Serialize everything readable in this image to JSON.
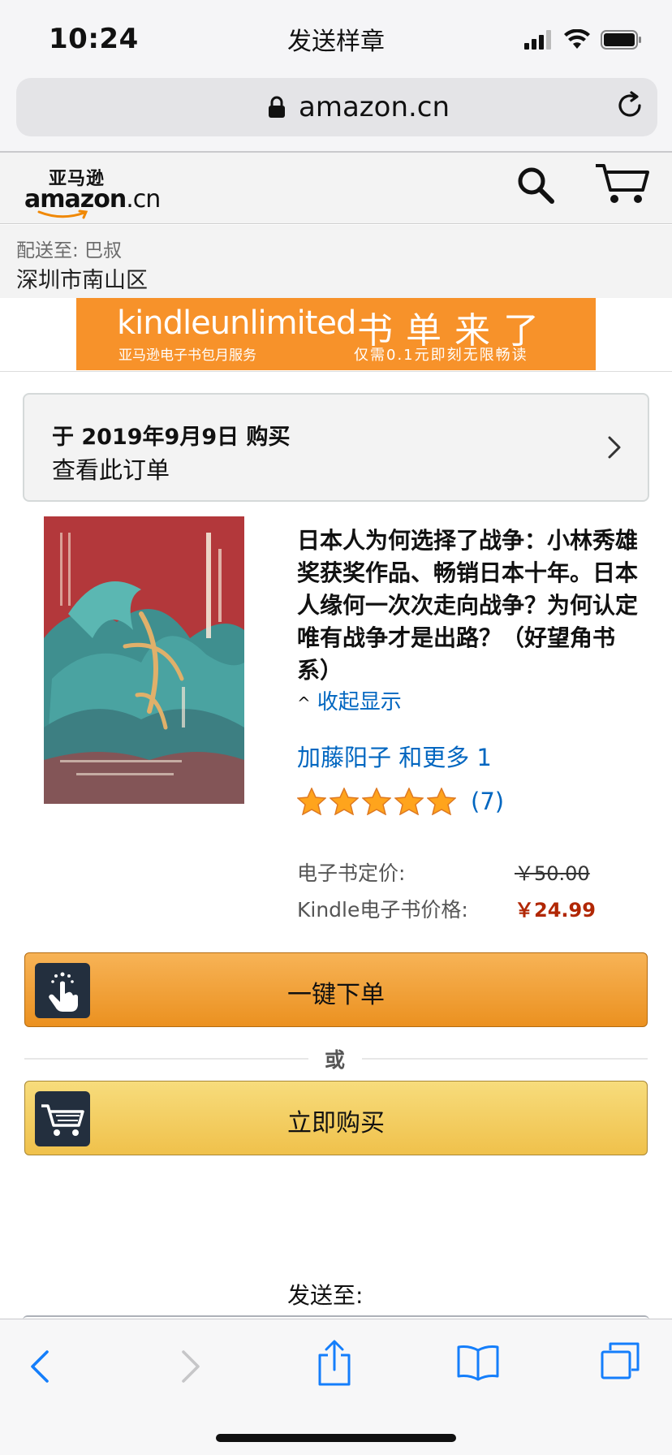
{
  "status_bar": {
    "time": "10:24"
  },
  "browser": {
    "url": "amazon.cn"
  },
  "header": {
    "logo_cn": "亚马逊",
    "logo_en": "amazon",
    "logo_suffix": ".cn"
  },
  "delivery": {
    "label": "配送至: 巴叔",
    "area": "深圳市南山区"
  },
  "banner": {
    "brand": "kindleunlimited",
    "brand_sub": "亚马逊电子书包月服务",
    "headline": "书单来了",
    "subline": "仅需0.1元即刻无限畅读",
    "bg_color": "#f7922a"
  },
  "order": {
    "date_text": "于 2019年9月9日 购买",
    "link_text": "查看此订单"
  },
  "book": {
    "title": "日本人为何选择了战争：小林秀雄奖获奖作品、畅销日本十年。日本人缘何一次次走向战争？为何认定唯有战争才是出路？（好望角书系）",
    "collapse_label": "收起显示",
    "author": "加藤阳子 和更多 1",
    "rating": 5,
    "rating_count": "(7)"
  },
  "prices": {
    "list_label": "电子书定价:",
    "list_value": "￥50.00",
    "kindle_label": "Kindle电子书价格:",
    "kindle_value": "￥24.99"
  },
  "buttons": {
    "one_click": "一键下单",
    "or": "或",
    "buy_now": "立即购买",
    "send_sample": "发送样章",
    "send_to": "发送至:"
  },
  "colors": {
    "link": "#0066c0",
    "price": "#b12704",
    "one_click": "#eb9120",
    "buy_now": "#f0c14b"
  }
}
